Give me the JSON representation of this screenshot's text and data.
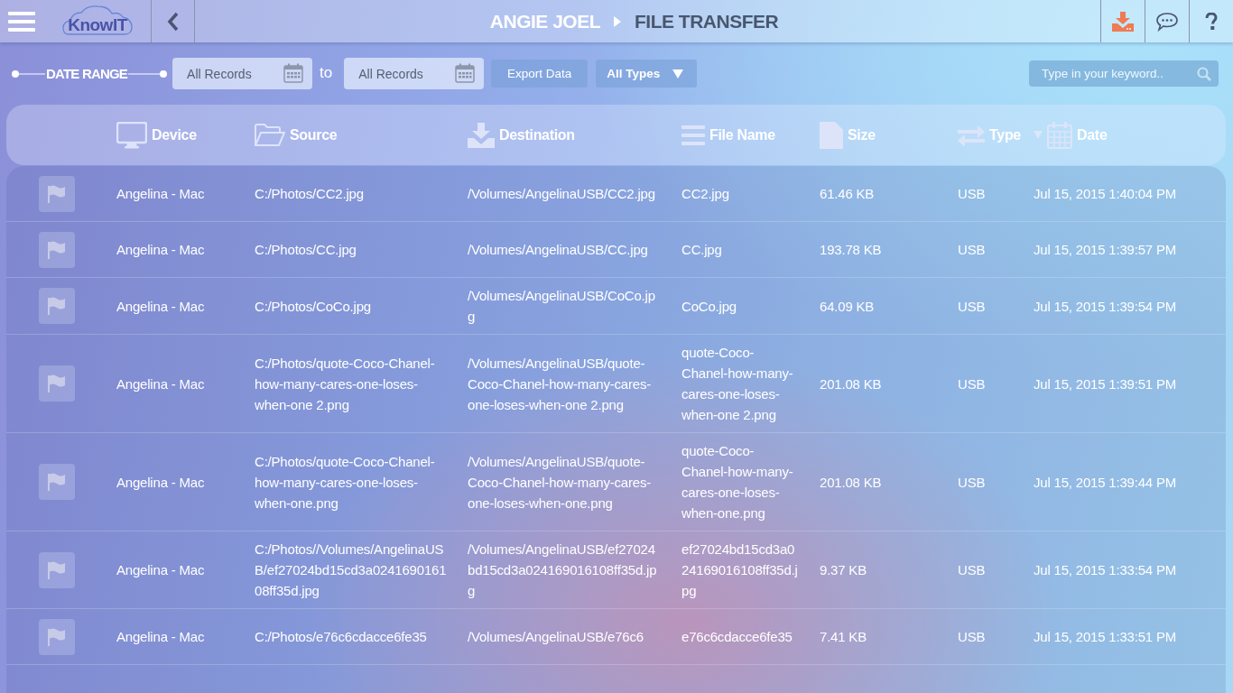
{
  "header": {
    "logo": "KnowIT",
    "breadcrumb": [
      "ANGIE JOEL",
      "FILE TRANSFER"
    ]
  },
  "filters": {
    "date_range_label": "DATE RANGE",
    "from": {
      "value": "All Records"
    },
    "to_label": "to",
    "to": {
      "value": "All Records"
    },
    "export_button": "Export Data",
    "type_dropdown": "All Types",
    "search": {
      "placeholder": "Type in your keyword.."
    }
  },
  "table": {
    "columns": [
      {
        "label": "Device",
        "sorted": false
      },
      {
        "label": "Source",
        "sorted": false
      },
      {
        "label": "Destination",
        "sorted": false
      },
      {
        "label": "File Name",
        "sorted": false
      },
      {
        "label": "Size",
        "sorted": false
      },
      {
        "label": "Type",
        "sorted": false
      },
      {
        "label": "Date",
        "sorted": true
      }
    ],
    "rows": [
      {
        "device": "Angelina - Mac",
        "source": "C:/Photos/CC2.jpg",
        "destination": "/Volumes/AngelinaUSB/CC2.jpg",
        "file_name": "CC2.jpg",
        "size": "61.46 KB",
        "type": "USB",
        "date": "Jul 15, 2015 1:40:04 PM"
      },
      {
        "device": "Angelina - Mac",
        "source": "C:/Photos/CC.jpg",
        "destination": "/Volumes/AngelinaUSB/CC.jpg",
        "file_name": "CC.jpg",
        "size": "193.78 KB",
        "type": "USB",
        "date": "Jul 15, 2015 1:39:57 PM"
      },
      {
        "device": "Angelina - Mac",
        "source": "C:/Photos/CoCo.jpg",
        "destination": "/Volumes/AngelinaUSB/CoCo.jpg",
        "file_name": "CoCo.jpg",
        "size": "64.09 KB",
        "type": "USB",
        "date": "Jul 15, 2015 1:39:54 PM"
      },
      {
        "device": "Angelina - Mac",
        "source": "C:/Photos/quote-Coco-Chanel-how-many-cares-one-loses-when-one 2.png",
        "destination": "/Volumes/AngelinaUSB/quote-Coco-Chanel-how-many-cares-one-loses-when-one 2.png",
        "file_name": "quote-Coco-Chanel-how-many-cares-one-loses-when-one 2.png",
        "size": "201.08 KB",
        "type": "USB",
        "date": "Jul 15, 2015 1:39:51 PM"
      },
      {
        "device": "Angelina - Mac",
        "source": "C:/Photos/quote-Coco-Chanel-how-many-cares-one-loses-when-one.png",
        "destination": "/Volumes/AngelinaUSB/quote-Coco-Chanel-how-many-cares-one-loses-when-one.png",
        "file_name": "quote-Coco-Chanel-how-many-cares-one-loses-when-one.png",
        "size": "201.08 KB",
        "type": "USB",
        "date": "Jul 15, 2015 1:39:44 PM"
      },
      {
        "device": "Angelina - Mac",
        "source": "C:/Photos//Volumes/AngelinaUSB/ef27024bd15cd3a024169016108ff35d.jpg",
        "destination": "/Volumes/AngelinaUSB/ef27024bd15cd3a024169016108ff35d.jpg",
        "file_name": "ef27024bd15cd3a024169016108ff35d.jpg",
        "size": "9.37 KB",
        "type": "USB",
        "date": "Jul 15, 2015 1:33:54 PM"
      },
      {
        "device": "Angelina - Mac",
        "source": "C:/Photos/e76c6cdacce6fe35",
        "destination": "/Volumes/AngelinaUSB/e76c6",
        "file_name": "e76c6cdacce6fe35",
        "size": "7.41 KB",
        "type": "USB",
        "date": "Jul 15, 2015 1:33:51 PM"
      }
    ]
  }
}
